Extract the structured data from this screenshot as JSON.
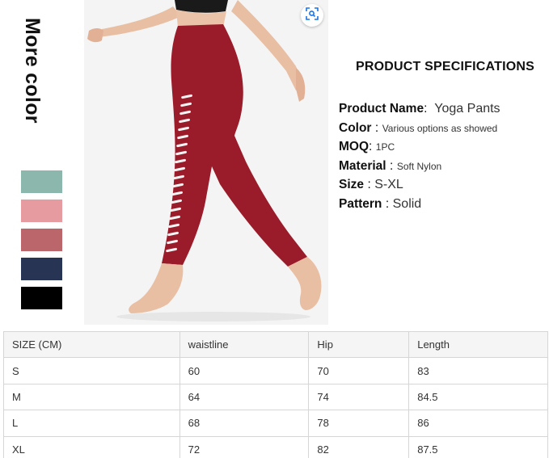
{
  "more_color_title": "More color",
  "swatches": [
    {
      "name": "sage green",
      "color": "#8cb7ad"
    },
    {
      "name": "pink",
      "color": "#e69ba1"
    },
    {
      "name": "dusty rose",
      "color": "#bb666a"
    },
    {
      "name": "navy",
      "color": "#273453"
    },
    {
      "name": "black",
      "color": "#000000"
    }
  ],
  "product_color": "#9a1c2a",
  "zoom_icon": "zoom-scan-icon",
  "specs": {
    "title": "PRODUCT SPECIFICATIONS",
    "product_name": {
      "label": "Product Name",
      "sep": ":",
      "value": "Yoga Pants"
    },
    "color": {
      "label": "Color",
      "sep": ":",
      "value": "Various options as showed"
    },
    "moq": {
      "label": "MOQ",
      "sep": ":",
      "value": "1PC"
    },
    "material": {
      "label": "Material",
      "sep": ":",
      "value": "Soft Nylon"
    },
    "size": {
      "label": "Size",
      "sep": ":",
      "value": "S-XL"
    },
    "pattern": {
      "label": "Pattern",
      "sep": ":",
      "value": "Solid"
    }
  },
  "size_table": {
    "headers": [
      "SIZE (CM)",
      "waistline",
      "Hip",
      "Length"
    ],
    "rows": [
      [
        "S",
        "60",
        "70",
        "83"
      ],
      [
        "M",
        "64",
        "74",
        "84.5"
      ],
      [
        "L",
        "68",
        "78",
        "86"
      ],
      [
        "XL",
        "72",
        "82",
        "87.5"
      ]
    ]
  }
}
